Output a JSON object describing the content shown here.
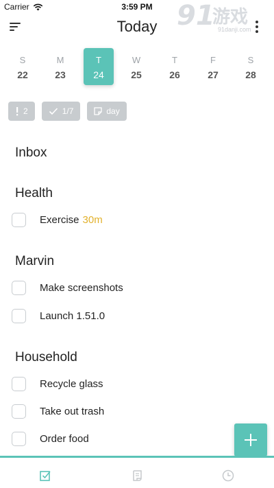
{
  "status_bar": {
    "carrier": "Carrier",
    "time": "3:59 PM"
  },
  "watermark": {
    "logo_number": "91",
    "logo_text": "游戏",
    "site": "91danji.com"
  },
  "header": {
    "title": "Today",
    "menu_icon": "menu-icon",
    "more_icon": "more-vertical-icon"
  },
  "week": [
    {
      "letter": "S",
      "date": "22",
      "selected": false
    },
    {
      "letter": "M",
      "date": "23",
      "selected": false
    },
    {
      "letter": "T",
      "date": "24",
      "selected": true
    },
    {
      "letter": "W",
      "date": "25",
      "selected": false
    },
    {
      "letter": "T",
      "date": "26",
      "selected": false
    },
    {
      "letter": "F",
      "date": "27",
      "selected": false
    },
    {
      "letter": "S",
      "date": "28",
      "selected": false
    }
  ],
  "filters": [
    {
      "icon": "priority-icon",
      "label": "2"
    },
    {
      "icon": "check-icon",
      "label": "1/7"
    },
    {
      "icon": "note-icon",
      "label": "day"
    }
  ],
  "sections": [
    {
      "title": "Inbox",
      "tasks": []
    },
    {
      "title": "Health",
      "tasks": [
        {
          "label": "Exercise",
          "time": "30m"
        }
      ]
    },
    {
      "title": "Marvin",
      "tasks": [
        {
          "label": "Make screenshots"
        },
        {
          "label": "Launch 1.51.0"
        }
      ]
    },
    {
      "title": "Household",
      "tasks": [
        {
          "label": "Recycle glass"
        },
        {
          "label": "Take out trash"
        },
        {
          "label": "Order food"
        }
      ]
    }
  ],
  "fab_icon": "plus-icon",
  "tabbar": [
    {
      "icon": "checkbox-tab-icon",
      "active": true
    },
    {
      "icon": "scroll-tab-icon",
      "active": false
    },
    {
      "icon": "clock-tab-icon",
      "active": false
    }
  ],
  "colors": {
    "accent": "#5bc3b7",
    "time_highlight": "#e2b12c",
    "chip_bg": "#c8cccf",
    "muted": "#9ea3a8"
  }
}
